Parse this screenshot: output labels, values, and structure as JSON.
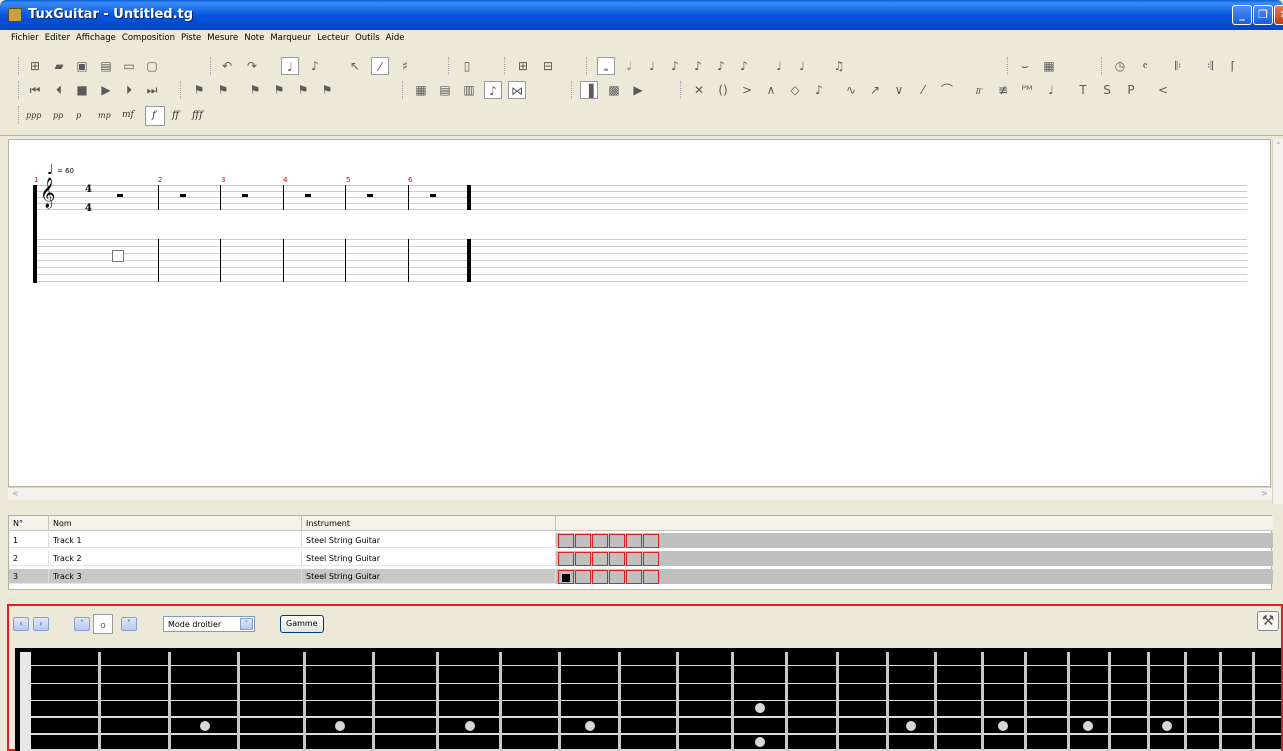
{
  "window": {
    "title": "TuxGuitar - Untitled.tg"
  },
  "menu": [
    "Fichier",
    "Editer",
    "Affichage",
    "Composition",
    "Piste",
    "Mesure",
    "Note",
    "Marqueur",
    "Lecteur",
    "Outils",
    "Aide"
  ],
  "dynamics": [
    "ppp",
    "pp",
    "p",
    "mp",
    "mf",
    "f",
    "ff",
    "fff"
  ],
  "score": {
    "tempo": "= 60",
    "time_signature": {
      "numerator": "4",
      "denominator": "4"
    },
    "measure_numbers": [
      "1",
      "2",
      "3",
      "4",
      "5",
      "6"
    ]
  },
  "tracks": {
    "headers": {
      "number": "N°",
      "name": "Nom",
      "instrument": "Instrument"
    },
    "rows": [
      {
        "number": "1",
        "name": "Track 1",
        "instrument": "Steel String Guitar"
      },
      {
        "number": "2",
        "name": "Track 2",
        "instrument": "Steel String Guitar"
      },
      {
        "number": "3",
        "name": "Track 3",
        "instrument": "Steel String Guitar"
      }
    ]
  },
  "fretboard": {
    "mode_select": "Mode droitier",
    "scale_button": "Gamme"
  },
  "colors": {
    "title_bar": "#0555e0",
    "measure_number": "#e00000",
    "fretboard_panel_border": "#e02020",
    "selected_row": "#c8c8c8"
  }
}
